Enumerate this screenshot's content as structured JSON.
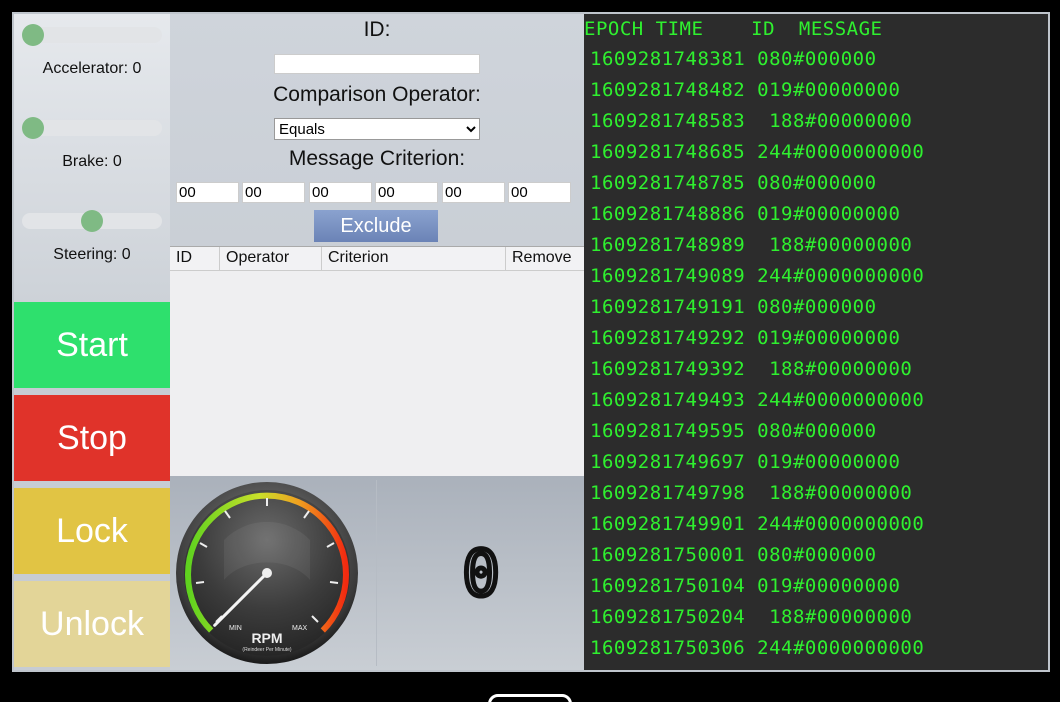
{
  "controls": {
    "accelerator": {
      "label": "Accelerator: 0",
      "value_fraction": 0.0
    },
    "brake": {
      "label": "Brake: 0",
      "value_fraction": 0.0
    },
    "steering": {
      "label": "Steering: 0",
      "value_fraction": 0.5
    }
  },
  "buttons": {
    "start": {
      "label": "Start",
      "color": "#2ee06d"
    },
    "stop": {
      "label": "Stop",
      "color": "#e0332a"
    },
    "lock": {
      "label": "Lock",
      "color": "#e1c444"
    },
    "unlock": {
      "label": "Unlock",
      "color": "#e3d598"
    }
  },
  "filter": {
    "id_label": "ID:",
    "id_value": "",
    "operator_label": "Comparison Operator:",
    "operator_value": "Equals",
    "criterion_label": "Message Criterion:",
    "criterion_bytes": [
      "00",
      "00",
      "00",
      "00",
      "00",
      "00"
    ],
    "exclude_label": "Exclude",
    "table_headers": [
      "ID",
      "Operator",
      "Criterion",
      "Remove"
    ]
  },
  "rpm_gauge": {
    "min_label": "MIN",
    "max_label": "MAX",
    "title": "RPM",
    "subtitle": "(Reindeer Per Minute)",
    "needle_fraction": 0.0
  },
  "speed_display": {
    "value": "0"
  },
  "log": {
    "header": "EPOCH TIME    ID  MESSAGE",
    "rows": [
      "1609281748381 080#000000",
      "1609281748482 019#00000000",
      "1609281748583  188#00000000",
      "1609281748685 244#0000000000",
      "1609281748785 080#000000",
      "1609281748886 019#00000000",
      "1609281748989  188#00000000",
      "1609281749089 244#0000000000",
      "1609281749191 080#000000",
      "1609281749292 019#00000000",
      "1609281749392  188#00000000",
      "1609281749493 244#0000000000",
      "1609281749595 080#000000",
      "1609281749697 019#00000000",
      "1609281749798  188#00000000",
      "1609281749901 244#0000000000",
      "1609281750001 080#000000",
      "1609281750104 019#00000000",
      "1609281750204  188#00000000",
      "1609281750306 244#0000000000"
    ]
  }
}
